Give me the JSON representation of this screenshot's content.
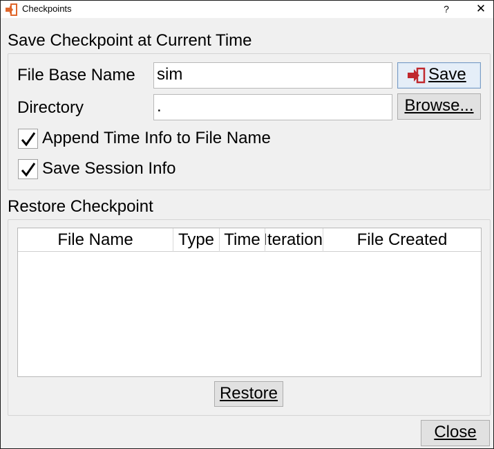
{
  "window": {
    "title": "Checkpoints",
    "help_label": "?",
    "close_glyph": "✕"
  },
  "save_section": {
    "title": "Save Checkpoint at Current Time",
    "file_base_name_label": "File Base Name",
    "file_base_name_value": "sim",
    "directory_label": "Directory",
    "directory_value": ".",
    "save_button_label": "Save",
    "browse_button_label": "Browse...",
    "append_time_label": "Append Time Info to File Name",
    "append_time_checked": true,
    "save_session_label": "Save Session Info",
    "save_session_checked": true
  },
  "restore_section": {
    "title": "Restore Checkpoint",
    "columns": [
      "File Name",
      "Type",
      "Time",
      "Iteration",
      "File Created"
    ],
    "rows": [],
    "restore_button_label": "Restore"
  },
  "footer": {
    "close_button_label": "Close"
  },
  "colors": {
    "window_bg": "#f0f0f0",
    "save_icon_accent": "#c0282d"
  }
}
